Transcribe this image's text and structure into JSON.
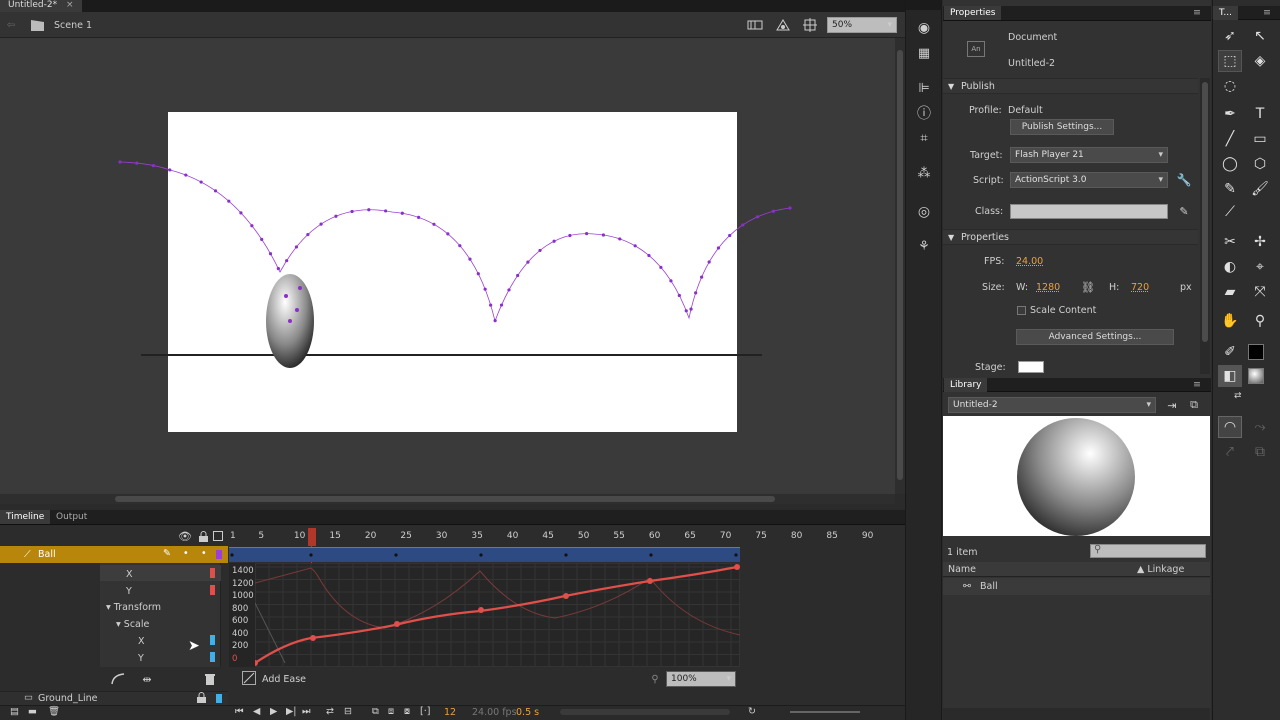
{
  "doc_tab": {
    "label": "Untitled-2*"
  },
  "edit_bar": {
    "scene": "Scene 1",
    "zoom": "50%"
  },
  "timeline": {
    "tabs": [
      "Timeline",
      "Output"
    ],
    "frame_numbers": [
      "1",
      "5",
      "10",
      "15",
      "20",
      "25",
      "30",
      "35",
      "40",
      "45",
      "50",
      "55",
      "60",
      "65",
      "70",
      "75",
      "80",
      "85",
      "90"
    ],
    "layer_ball": "Ball",
    "layer_ground": "Ground_Line",
    "props": {
      "x": "X",
      "y": "Y",
      "transform": "Transform",
      "scale": "Scale",
      "sx": "X",
      "sy": "Y"
    },
    "y_ticks": [
      "1400",
      "1200",
      "1000",
      "800",
      "600",
      "400",
      "200",
      "0"
    ],
    "add_ease": "Add Ease",
    "graph_zoom": "100%",
    "current_frame": "12",
    "fps": "24.00 fps",
    "time": "0.5 s"
  },
  "properties": {
    "title": "Properties",
    "doc_label": "Document",
    "doc_name": "Untitled-2",
    "publish_section": "Publish",
    "profile_label": "Profile:",
    "profile_value": "Default",
    "publish_settings": "Publish Settings...",
    "target_label": "Target:",
    "target_value": "Flash Player 21",
    "script_label": "Script:",
    "script_value": "ActionScript 3.0",
    "class_label": "Class:",
    "props_section": "Properties",
    "fps_label": "FPS:",
    "fps_value": "24.00",
    "size_label": "Size:",
    "w_label": "W:",
    "w_value": "1280",
    "h_label": "H:",
    "h_value": "720",
    "px": "px",
    "scale_content": "Scale Content",
    "advanced": "Advanced Settings...",
    "stage_label": "Stage:"
  },
  "library": {
    "title": "Library",
    "doc": "Untitled-2",
    "count": "1 item",
    "col_name": "Name",
    "col_linkage": "Linkage",
    "item": "Ball"
  },
  "tools_title": "T...",
  "colors": {
    "accent": "#9b3fd6",
    "curve": "#e0504a",
    "selection": "#b8860b",
    "frames": "#2e4a82"
  }
}
